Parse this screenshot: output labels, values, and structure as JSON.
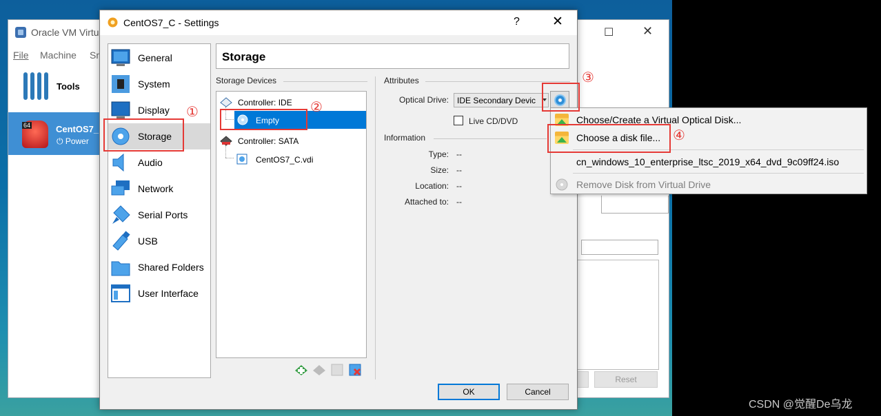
{
  "main_window": {
    "title": "Oracle VM Virtu",
    "menu": [
      "File",
      "Machine",
      "Sn"
    ],
    "tools_label": "Tools",
    "vm_badge": "64",
    "vm_name": "CentOS7_",
    "vm_state": "Power",
    "reset_label": "Reset"
  },
  "dialog": {
    "title": "CentOS7_C - Settings",
    "help": "?",
    "close": "✕",
    "sidebar": [
      {
        "label": "General"
      },
      {
        "label": "System"
      },
      {
        "label": "Display"
      },
      {
        "label": "Storage"
      },
      {
        "label": "Audio"
      },
      {
        "label": "Network"
      },
      {
        "label": "Serial Ports"
      },
      {
        "label": "USB"
      },
      {
        "label": "Shared Folders"
      },
      {
        "label": "User Interface"
      }
    ],
    "page_title": "Storage",
    "storage_devices_label": "Storage Devices",
    "tree": {
      "controller_ide": "Controller: IDE",
      "empty": "Empty",
      "controller_sata": "Controller: SATA",
      "vdi": "CentOS7_C.vdi"
    },
    "attributes_label": "Attributes",
    "optical_drive_label": "Optical Drive:",
    "optical_drive_value": "IDE Secondary Devic",
    "live_cd_label": "Live CD/DVD",
    "information_label": "Information",
    "info": [
      {
        "label": "Type:",
        "value": "--"
      },
      {
        "label": "Size:",
        "value": "--"
      },
      {
        "label": "Location:",
        "value": "--"
      },
      {
        "label": "Attached to:",
        "value": "--"
      }
    ],
    "ok_label": "OK",
    "cancel_label": "Cancel"
  },
  "popup_menu": [
    {
      "label": "Choose/Create a Virtual Optical Disk..."
    },
    {
      "label": "Choose a disk file..."
    },
    {
      "label": "cn_windows_10_enterprise_ltsc_2019_x64_dvd_9c09ff24.iso"
    },
    {
      "label": "Remove Disk from Virtual Drive"
    }
  ],
  "annotations": [
    "①",
    "②",
    "③",
    "④"
  ],
  "annotation_color": "#e53935",
  "selection_color": "#0078d7",
  "watermark": "CSDN @觉醒De乌龙"
}
